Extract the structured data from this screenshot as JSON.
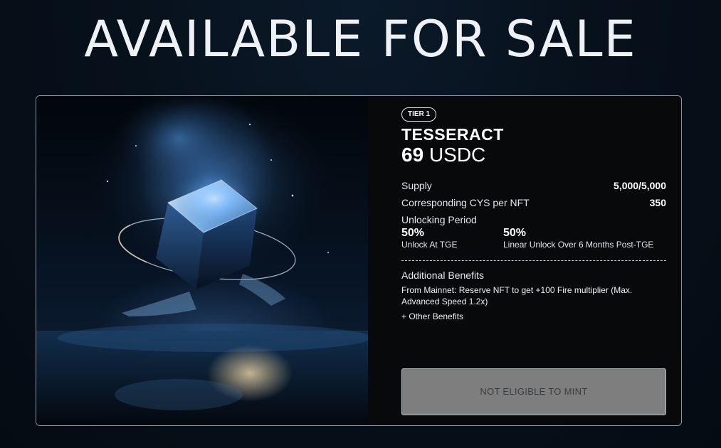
{
  "page": {
    "title": "AVAILABLE FOR SALE"
  },
  "card": {
    "image": {
      "icon": "glowing-cube-artwork"
    },
    "tier_badge": "TIER 1",
    "name": "TESSERACT",
    "price": {
      "amount": "69",
      "currency": "USDC"
    },
    "supply": {
      "label": "Supply",
      "value": "5,000/5,000"
    },
    "cys": {
      "label": "Corresponding CYS per NFT",
      "value": "350"
    },
    "unlocking": {
      "label": "Unlocking Period",
      "items": [
        {
          "percent": "50%",
          "description": "Unlock At TGE"
        },
        {
          "percent": "50%",
          "description": "Linear Unlock Over 6 Months Post-TGE"
        }
      ]
    },
    "benefits": {
      "title": "Additional Benefits",
      "items": [
        "From Mainnet: Reserve NFT to get +100 Fire multiplier (Max. Advanced Speed 1.2x)",
        "+ Other Benefits"
      ]
    },
    "mint_button": {
      "label": "NOT ELIGIBLE TO MINT",
      "enabled": false
    }
  },
  "colors": {
    "background": "#07111c",
    "card_border": "#8d96a3",
    "button_bg": "#7e7e7e",
    "button_text": "#3a3d40"
  }
}
